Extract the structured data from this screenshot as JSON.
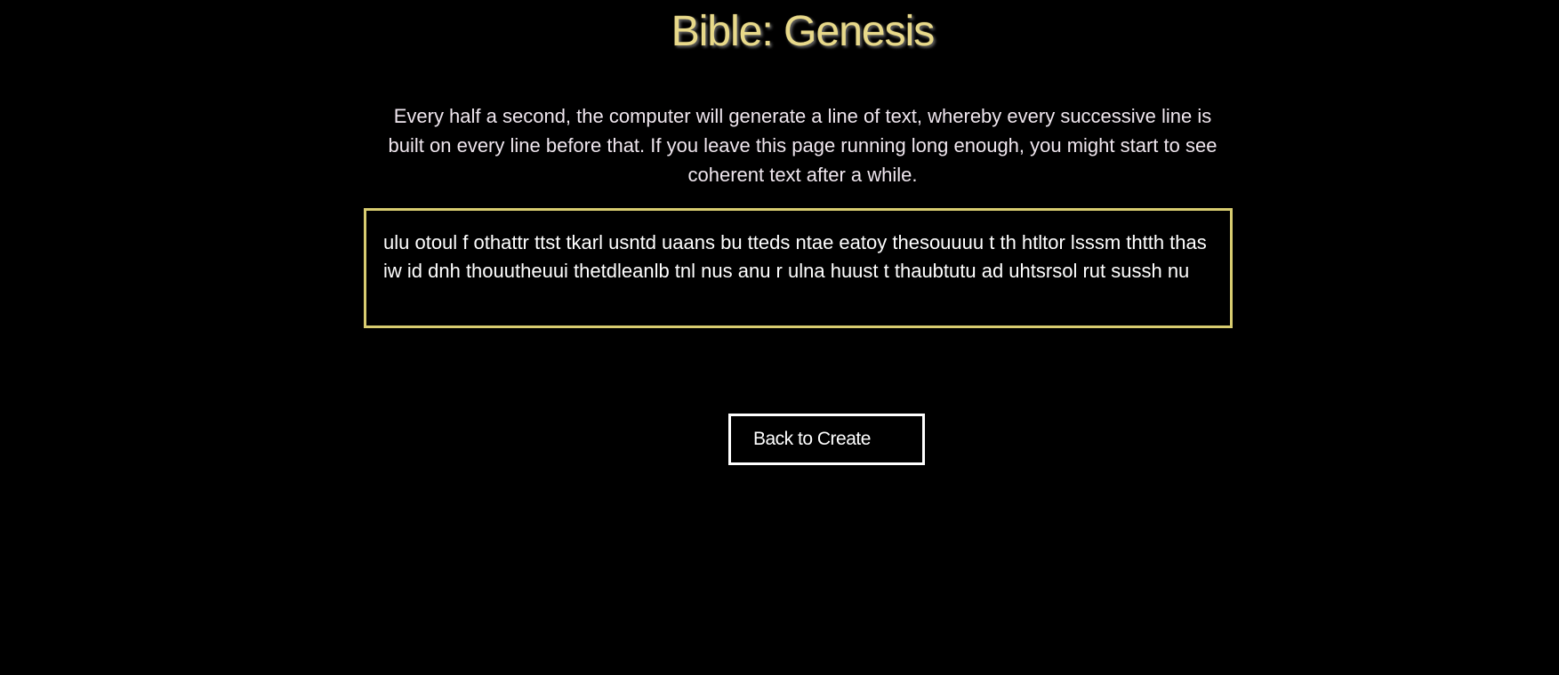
{
  "header": {
    "title": "Bible: Genesis"
  },
  "main": {
    "description": "Every half a second, the computer will generate a line of text, whereby every successive line is built on every line before that. If you leave this page running long enough, you might start to see coherent text after a while.",
    "generated_text": "ulu otoul f othattr ttst tkarl usntd uaans bu tteds ntae eatoy thesouuuu t th htltor lsssm thtth thas iw id dnh thouutheuui thetdleanlb tnl nus anu r ulna huust t thaubtutu ad uhtsrsol rut sussh nu",
    "back_button_label": "Back to Create"
  },
  "colors": {
    "background": "#000000",
    "title": "#e8d98a",
    "box_border": "#d8cc70",
    "text": "#ffffff"
  }
}
